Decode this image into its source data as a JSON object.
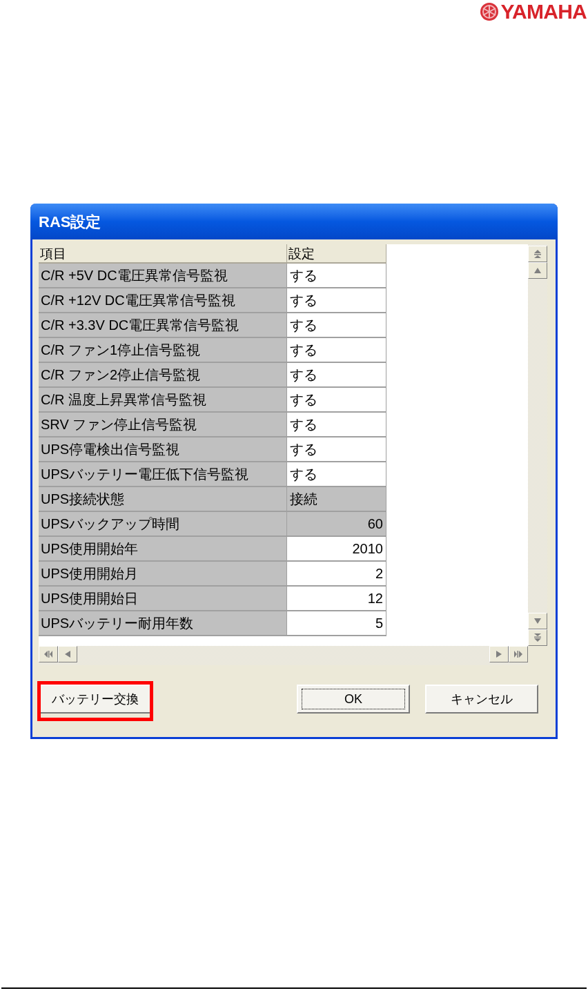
{
  "logo": {
    "text": "YAMAHA"
  },
  "dialog": {
    "title": "RAS設定",
    "table": {
      "columns": [
        "項目",
        "設定"
      ],
      "rows": [
        {
          "item": "C/R +5V DC電圧異常信号監視",
          "value": "する",
          "kind": "text",
          "editable": true
        },
        {
          "item": "C/R +12V DC電圧異常信号監視",
          "value": "する",
          "kind": "text",
          "editable": true
        },
        {
          "item": "C/R +3.3V DC電圧異常信号監視",
          "value": "する",
          "kind": "text",
          "editable": true
        },
        {
          "item": "C/R ファン1停止信号監視",
          "value": "する",
          "kind": "text",
          "editable": true
        },
        {
          "item": "C/R ファン2停止信号監視",
          "value": "する",
          "kind": "text",
          "editable": true
        },
        {
          "item": "C/R 温度上昇異常信号監視",
          "value": "する",
          "kind": "text",
          "editable": true
        },
        {
          "item": "SRV ファン停止信号監視",
          "value": "する",
          "kind": "text",
          "editable": true
        },
        {
          "item": "UPS停電検出信号監視",
          "value": "する",
          "kind": "text",
          "editable": true
        },
        {
          "item": "UPSバッテリー電圧低下信号監視",
          "value": "する",
          "kind": "text",
          "editable": true
        },
        {
          "item": "UPS接続状態",
          "value": "接続",
          "kind": "text",
          "editable": false
        },
        {
          "item": "UPSバックアップ時間",
          "value": "60",
          "kind": "number",
          "editable": false
        },
        {
          "item": "UPS使用開始年",
          "value": "2010",
          "kind": "number",
          "editable": true
        },
        {
          "item": "UPS使用開始月",
          "value": "2",
          "kind": "number",
          "editable": true
        },
        {
          "item": "UPS使用開始日",
          "value": "12",
          "kind": "number",
          "editable": true
        },
        {
          "item": "UPSバッテリー耐用年数",
          "value": "5",
          "kind": "number",
          "editable": true
        }
      ]
    },
    "buttons": [
      {
        "label": "バッテリー交換",
        "highlighted": true,
        "focused": false
      },
      {
        "label": "OK",
        "highlighted": false,
        "focused": true
      },
      {
        "label": "キャンセル",
        "highlighted": false,
        "focused": false
      }
    ]
  }
}
